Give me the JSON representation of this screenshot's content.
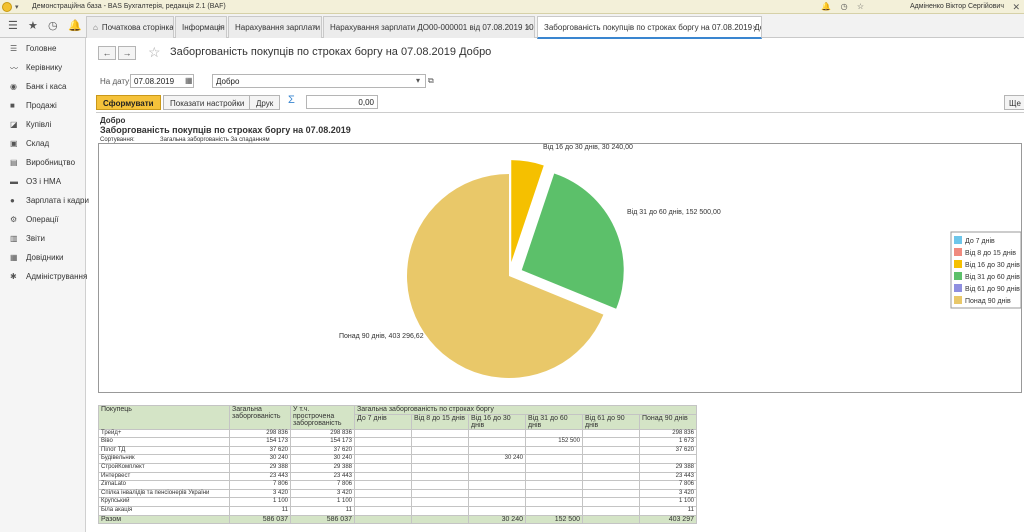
{
  "window": {
    "title": "Демонстраційна база - BAS Бухгалтерія, редакція 2.1  (BAF)",
    "user": "Адміненко Віктор Сергійович"
  },
  "tabs": [
    {
      "label": "Початкова сторінка"
    },
    {
      "label": "Інформація"
    },
    {
      "label": "Нарахування зарплати"
    },
    {
      "label": "Нарахування зарплати ДО00-000001 від 07.08.2019 10:39:58"
    },
    {
      "label": "Заборгованість покупців по строках боргу на 07.08.2019 Добро"
    }
  ],
  "sidebar": {
    "items": [
      {
        "label": "Головне",
        "icon": "menu-icon"
      },
      {
        "label": "Керівнику",
        "icon": "chart-line-icon"
      },
      {
        "label": "Банк і каса",
        "icon": "bank-icon"
      },
      {
        "label": "Продажі",
        "icon": "bag-icon"
      },
      {
        "label": "Купівлі",
        "icon": "cart-icon"
      },
      {
        "label": "Склад",
        "icon": "box-icon"
      },
      {
        "label": "Виробництво",
        "icon": "factory-icon"
      },
      {
        "label": "ОЗ і НМА",
        "icon": "truck-icon"
      },
      {
        "label": "Зарплата і кадри",
        "icon": "people-icon"
      },
      {
        "label": "Операції",
        "icon": "gear-icon"
      },
      {
        "label": "Звіти",
        "icon": "report-icon"
      },
      {
        "label": "Довідники",
        "icon": "book-icon"
      },
      {
        "label": "Адміністрування",
        "icon": "settings-icon"
      }
    ]
  },
  "page": {
    "title": "Заборгованість покупців по строках боргу на 07.08.2019 Добро"
  },
  "filters": {
    "date_label": "На дату:",
    "date_value": "07.08.2019",
    "org_value": "Добро"
  },
  "toolbar": {
    "generate": "Сформувати",
    "settings": "Показати настройки",
    "print": "Друк",
    "sum_value": "0,00",
    "more": "Ще"
  },
  "report": {
    "org": "Добро",
    "title": "Заборгованість покупців по строках боргу на 07.08.2019",
    "sort_label": "Сортування:",
    "sort_value": "Загальна заборгованість За спаданням"
  },
  "chart_data": {
    "type": "pie",
    "legend_position": "right",
    "slices": [
      {
        "name": "До 7 днів",
        "value": 0,
        "color": "#6ec6ea"
      },
      {
        "name": "Від 8 до 15 днів",
        "value": 0,
        "color": "#f08a7e"
      },
      {
        "name": "Від 16 до 30 днів",
        "value": 30240,
        "color": "#f5c000",
        "label": "Від 16 до 30 днів, 30 240,00"
      },
      {
        "name": "Від 31 до 60 днів",
        "value": 152500,
        "color": "#5cc06a",
        "label": "Від 31 до 60 днів, 152 500,00"
      },
      {
        "name": "Від 61 до 90 днів",
        "value": 0,
        "color": "#8f8fe0"
      },
      {
        "name": "Понад 90 днів",
        "value": 403296.62,
        "color": "#e9c869",
        "label": "Понад 90 днів, 403 296,62"
      }
    ]
  },
  "table": {
    "headers": {
      "buyer": "Покупець",
      "total": "Загальна заборгованість",
      "overdue": "У т.ч. прострочена заборгованість",
      "group": "Загальна заборгованість по строках боргу",
      "periods": [
        "До 7 днів",
        "Від 8 до 15 днів",
        "Від 16 до 30 днів",
        "Від 31 до 60 днів",
        "Від 61 до 90 днів",
        "Понад 90 днів"
      ]
    },
    "rows": [
      [
        "Трейд+",
        "298 836",
        "298 836",
        "",
        "",
        "",
        "",
        "",
        "298 836"
      ],
      [
        "Віво",
        "154 173",
        "154 173",
        "",
        "",
        "",
        "152 500",
        "",
        "1 673"
      ],
      [
        "Пілот ТД",
        "37 620",
        "37 620",
        "",
        "",
        "",
        "",
        "",
        "37 620"
      ],
      [
        "Будівельник",
        "30 240",
        "30 240",
        "",
        "",
        "30 240",
        "",
        "",
        ""
      ],
      [
        "СтройКомплект",
        "29 388",
        "29 388",
        "",
        "",
        "",
        "",
        "",
        "29 388"
      ],
      [
        "Интервест",
        "23 443",
        "23 443",
        "",
        "",
        "",
        "",
        "",
        "23 443"
      ],
      [
        "ZimaLato",
        "7 806",
        "7 806",
        "",
        "",
        "",
        "",
        "",
        "7 806"
      ],
      [
        "Спілка інвалідів та пенсіонерів України",
        "3 420",
        "3 420",
        "",
        "",
        "",
        "",
        "",
        "3 420"
      ],
      [
        "Крупський",
        "1 100",
        "1 100",
        "",
        "",
        "",
        "",
        "",
        "1 100"
      ],
      [
        "Біла акація",
        "11",
        "11",
        "",
        "",
        "",
        "",
        "",
        "11"
      ]
    ],
    "total": [
      "Разом",
      "586 037",
      "586 037",
      "",
      "",
      "30 240",
      "152 500",
      "",
      "403 297"
    ]
  }
}
